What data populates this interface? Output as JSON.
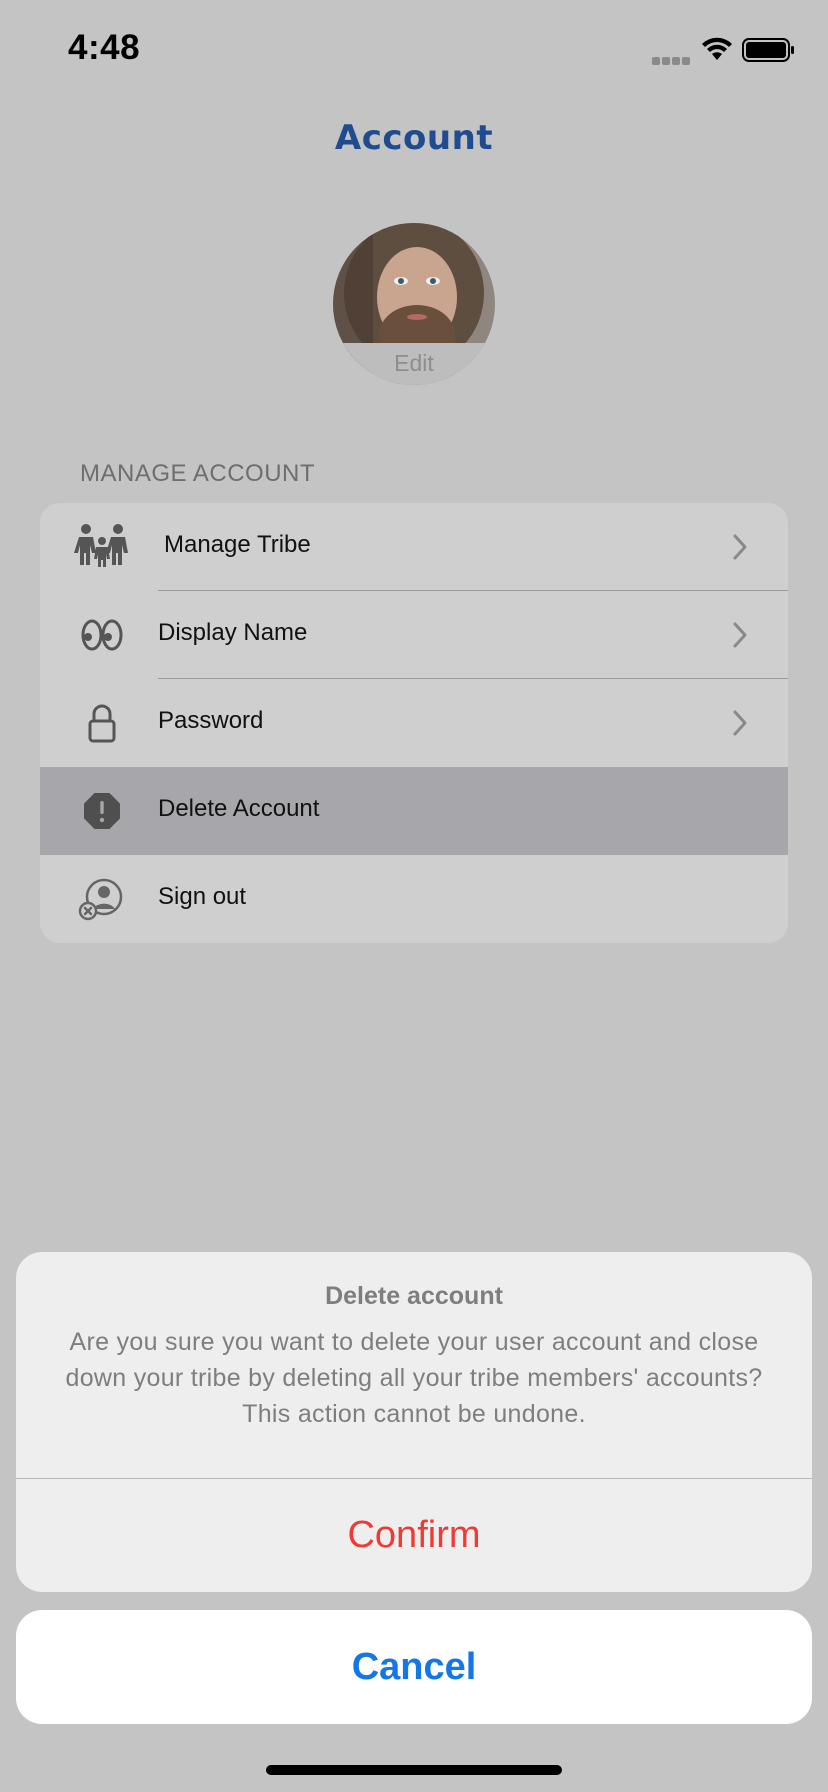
{
  "status_bar": {
    "time": "4:48"
  },
  "header": {
    "title": "Account"
  },
  "avatar": {
    "edit_label": "Edit"
  },
  "manage_account": {
    "section_title": "MANAGE ACCOUNT",
    "items": [
      {
        "label": "Manage  Tribe",
        "icon": "family-icon",
        "has_chevron": true
      },
      {
        "label": "Display Name",
        "icon": "eyes-icon",
        "has_chevron": true
      },
      {
        "label": "Password",
        "icon": "lock-icon",
        "has_chevron": true
      },
      {
        "label": "Delete Account",
        "icon": "exclamation-octagon-icon",
        "has_chevron": false,
        "highlighted": true
      },
      {
        "label": "Sign out",
        "icon": "person-remove-icon",
        "has_chevron": false
      }
    ]
  },
  "alert": {
    "title": "Delete account",
    "message": "Are you sure you want to delete your user account and close down your tribe by deleting all your tribe members' accounts? This action cannot be undone.",
    "confirm_label": "Confirm",
    "cancel_label": "Cancel"
  },
  "colors": {
    "title": "#1f4b8f",
    "destructive": "#ef3b33",
    "cancel": "#1576e6",
    "highlight_row": "#a7a7ab"
  }
}
